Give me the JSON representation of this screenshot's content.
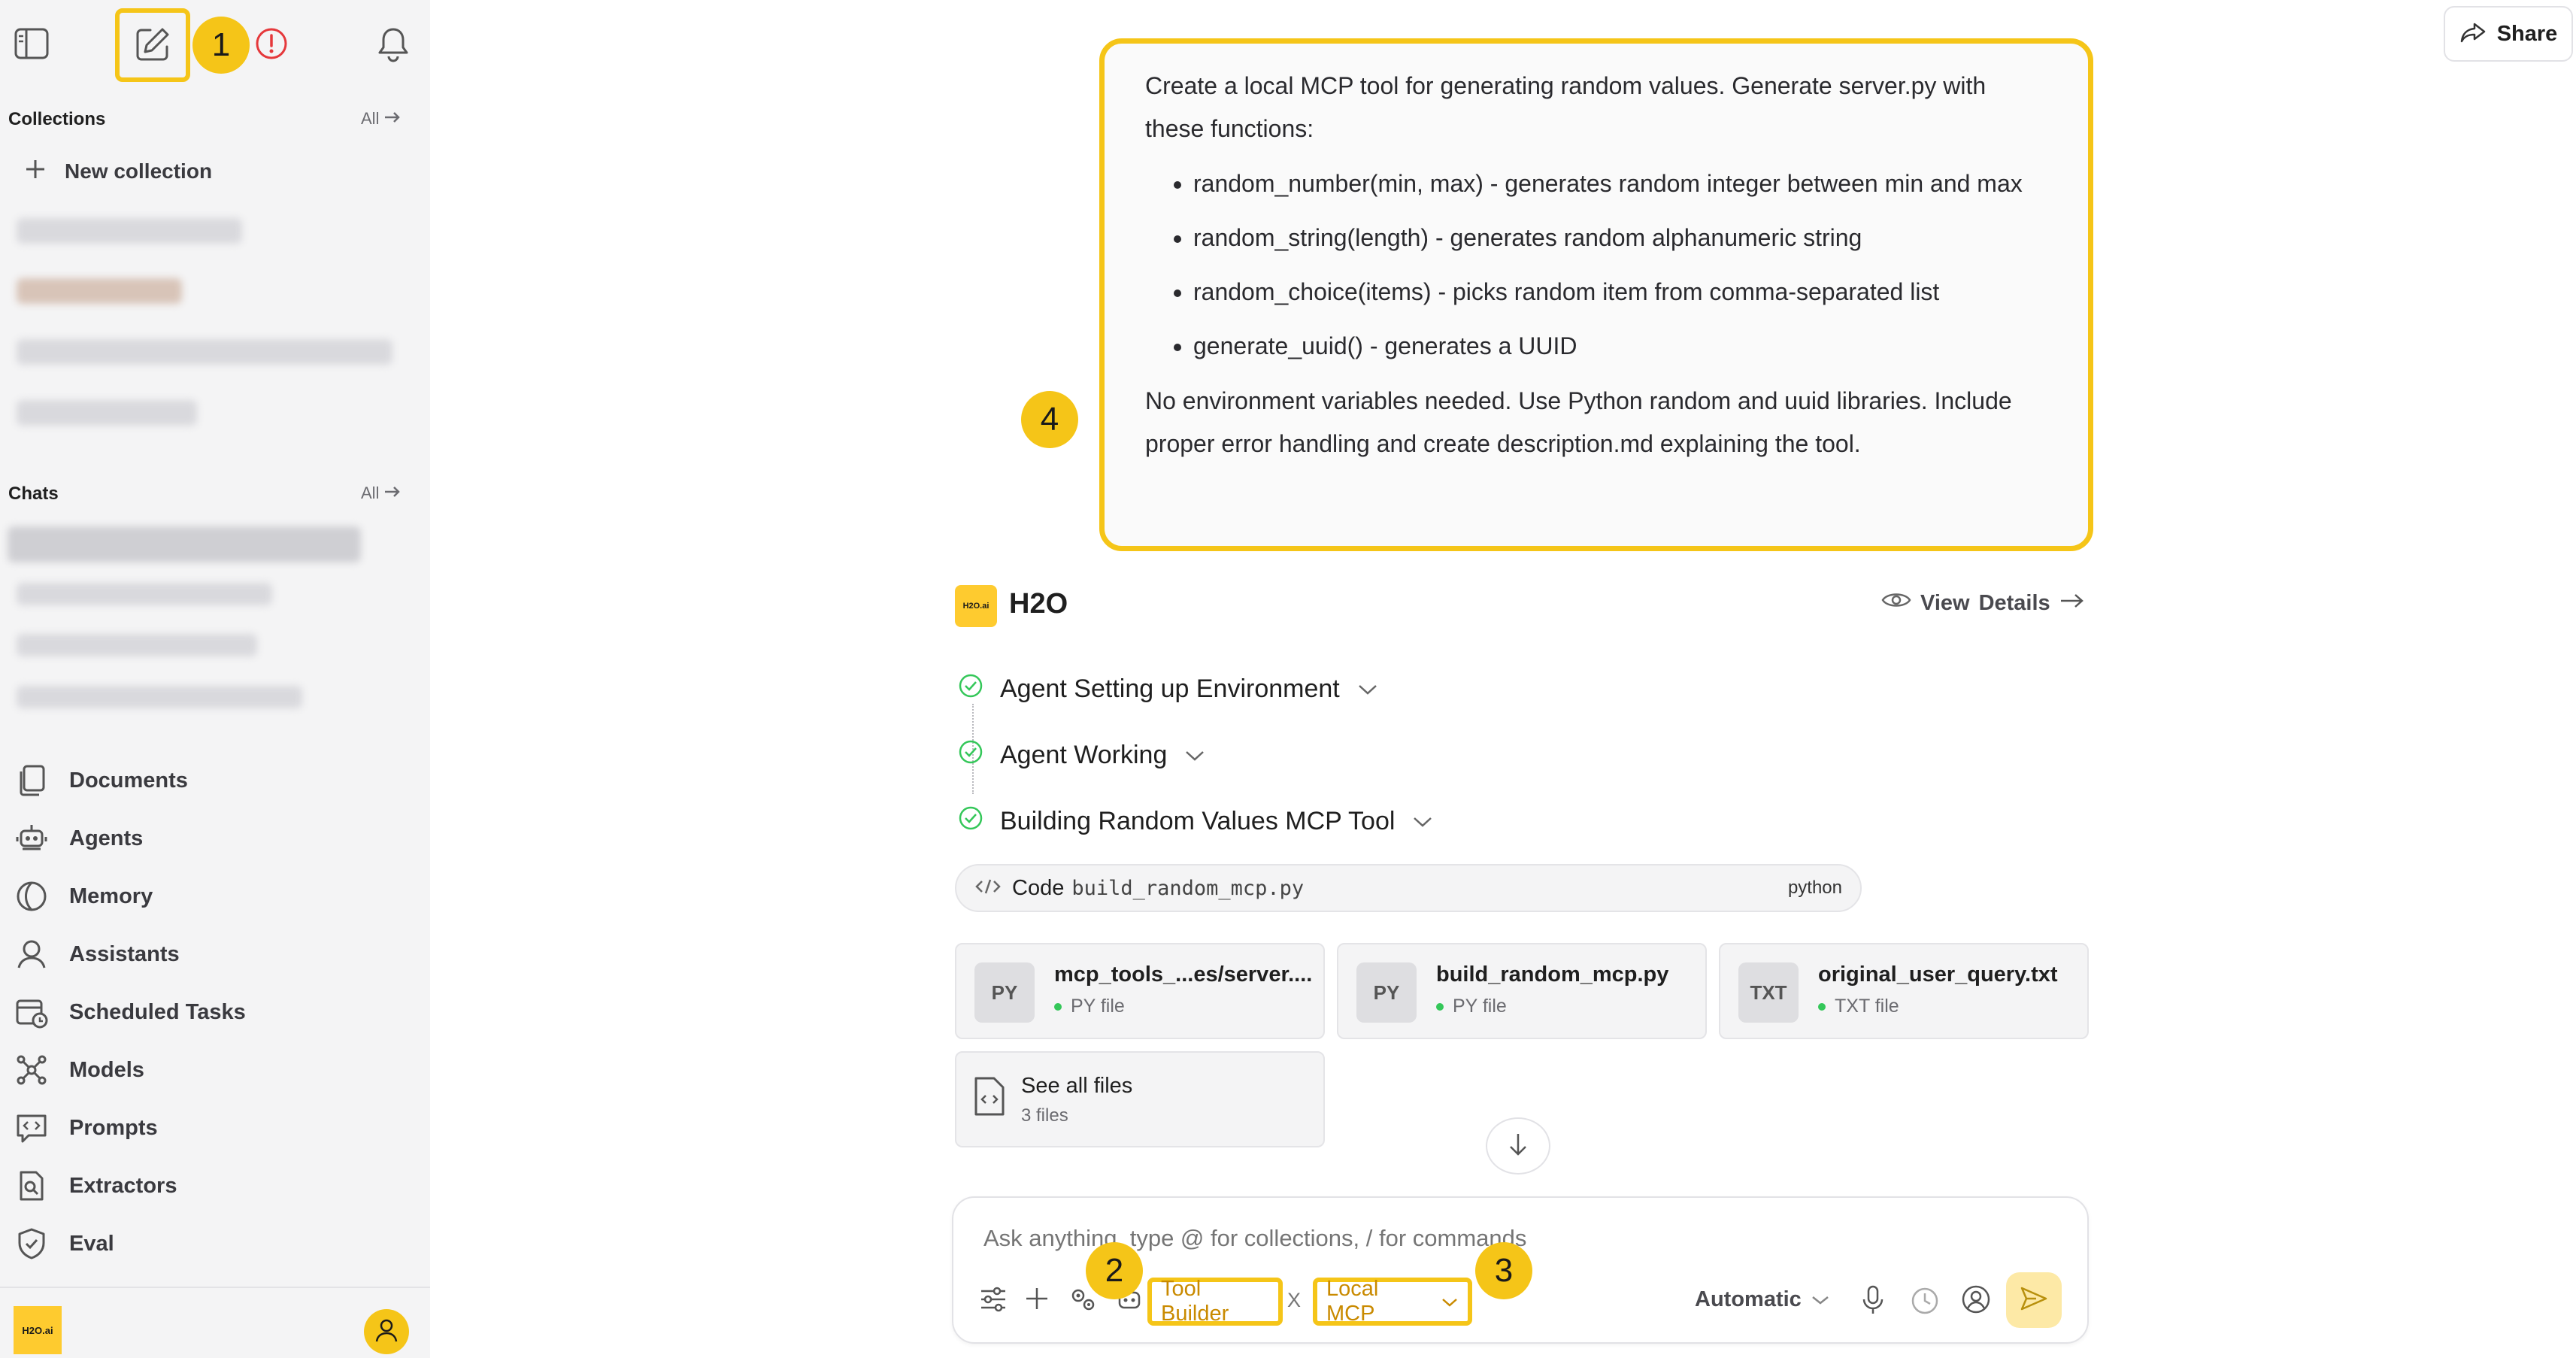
{
  "sidebar": {
    "collections_title": "Collections",
    "collections_all": "All",
    "new_collection": "New collection",
    "chats_title": "Chats",
    "chats_all": "All",
    "nav": [
      {
        "label": "Documents",
        "icon": "documents-icon"
      },
      {
        "label": "Agents",
        "icon": "robot-icon"
      },
      {
        "label": "Memory",
        "icon": "brain-icon"
      },
      {
        "label": "Assistants",
        "icon": "assistant-icon"
      },
      {
        "label": "Scheduled Tasks",
        "icon": "calendar-clock-icon"
      },
      {
        "label": "Models",
        "icon": "network-icon"
      },
      {
        "label": "Prompts",
        "icon": "prompt-icon"
      },
      {
        "label": "Extractors",
        "icon": "document-search-icon"
      },
      {
        "label": "Eval",
        "icon": "shield-check-icon"
      }
    ],
    "logo_text": "H2O.ai"
  },
  "header": {
    "share_label": "Share"
  },
  "annotations": {
    "badge1": "1",
    "badge2": "2",
    "badge3": "3",
    "badge4": "4"
  },
  "user_message": {
    "intro": "Create a local MCP tool for generating random values. Generate server.py with these functions:",
    "bullets": [
      "random_number(min, max) - generates random integer between min and max",
      "random_string(length) - generates random alphanumeric string",
      "random_choice(items) - picks random item from comma-separated list",
      "generate_uuid() - generates a UUID"
    ],
    "outro": "No environment variables needed. Use Python random and uuid libraries. Include proper error handling and create description.md explaining the tool."
  },
  "assistant": {
    "logo_text": "H2O.ai",
    "name": "H2O",
    "view_label": "View",
    "details_label": "Details",
    "steps": [
      "Agent Setting up Environment",
      "Agent Working",
      "Building Random Values MCP Tool"
    ],
    "code": {
      "label": "Code",
      "filename": "build_random_mcp.py",
      "language": "python"
    },
    "files": [
      {
        "tag": "PY",
        "name": "mcp_tools_...es/server....",
        "type": "PY file"
      },
      {
        "tag": "PY",
        "name": "build_random_mcp.py",
        "type": "PY file"
      },
      {
        "tag": "TXT",
        "name": "original_user_query.txt",
        "type": "TXT file"
      }
    ],
    "see_all": {
      "label": "See all files",
      "count": "3 files"
    }
  },
  "composer": {
    "placeholder": "Ask anything, type @ for collections, / for commands",
    "chip_tool_builder": "Tool Builder",
    "chip_separator": "X",
    "chip_local_mcp": "Local MCP",
    "mode": "Automatic"
  },
  "colors": {
    "highlight": "#f5c518",
    "sidebar_bg": "#f4f4f5",
    "success": "#34c759",
    "error": "#e5383b"
  }
}
